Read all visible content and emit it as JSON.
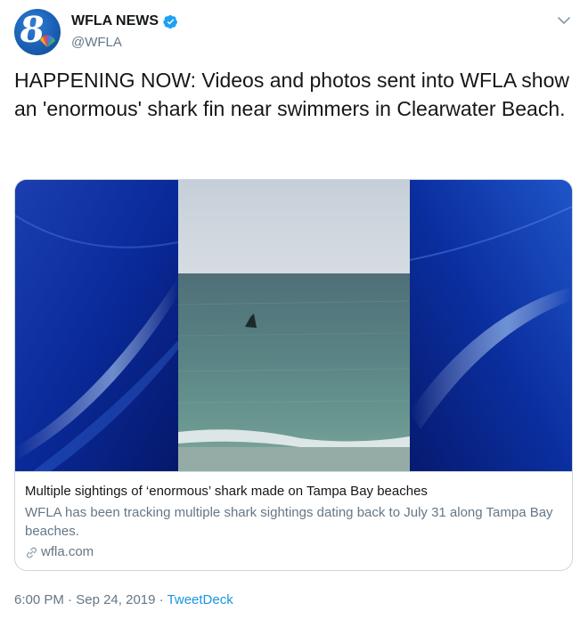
{
  "account": {
    "display_name": "WFLA NEWS",
    "handle": "@WFLA",
    "verified": true,
    "avatar_icon": "wfla-8-logo-icon"
  },
  "tweet": {
    "text": "HAPPENING NOW: Videos and photos sent into WFLA show an 'enormous' shark fin near swimmers in Clearwater Beach."
  },
  "card": {
    "title": "Multiple sightings of ‘enormous’ shark made on Tampa Bay beaches",
    "description": "WFLA has been tracking multiple shark sightings dating back to July 31 along Tampa Bay beaches.",
    "domain": "wfla.com",
    "image_icon": "shark-fin-ocean-photo"
  },
  "meta": {
    "time": "6:00 PM",
    "separator": " · ",
    "date": "Sep 24, 2019",
    "source": "TweetDeck"
  },
  "colors": {
    "link_blue": "#1b95e0",
    "verified_blue": "#1da1f2",
    "secondary_text": "#657786",
    "border": "#ccd6dd"
  }
}
